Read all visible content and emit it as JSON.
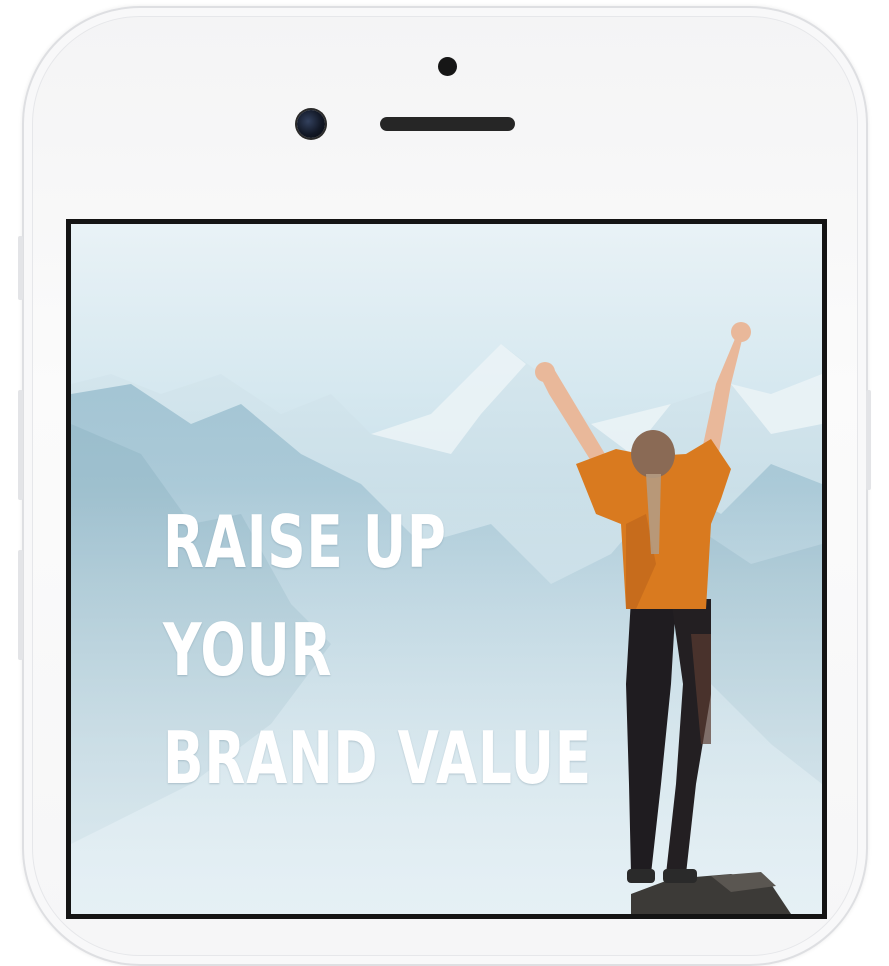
{
  "device": {
    "frame_color": "#f4f4f5",
    "screen_border_color": "#141414"
  },
  "screen": {
    "headline_lines": [
      "RAISE UP",
      "YOUR",
      "BRAND VALUE"
    ],
    "headline_color": "#ffffff",
    "sky_color": "#dbe9f0",
    "jacket_color": "#d97a1f"
  }
}
